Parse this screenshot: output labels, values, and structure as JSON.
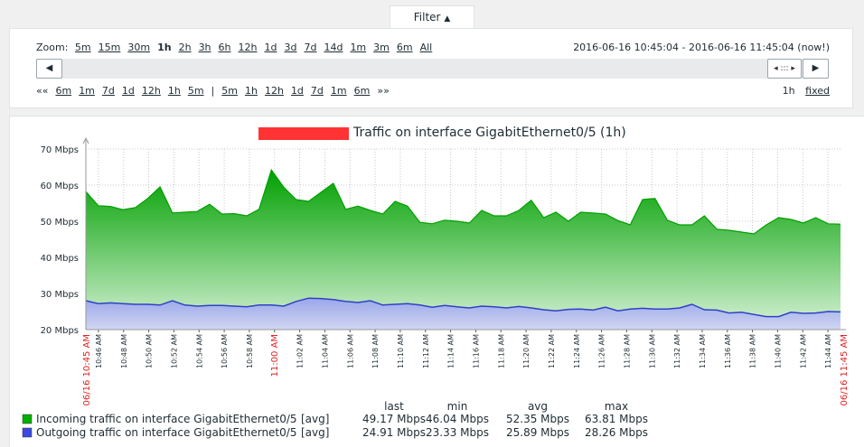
{
  "filter": {
    "label": "Filter",
    "arrow": "▲"
  },
  "zoom": {
    "label": "Zoom:",
    "options": [
      "5m",
      "15m",
      "30m",
      "1h",
      "2h",
      "3h",
      "6h",
      "12h",
      "1d",
      "3d",
      "7d",
      "14d",
      "1m",
      "3m",
      "6m",
      "All"
    ],
    "active": "1h"
  },
  "period_text": "2016-06-16 10:45:04 - 2016-06-16 11:45:04 (now!)",
  "scroll": {
    "left_arrow": "◀",
    "right_arrow": "▶",
    "handle": "◂ ::: ▸"
  },
  "nav": {
    "left_arrow": "««",
    "back": [
      "6m",
      "1m",
      "7d",
      "1d",
      "12h",
      "1h",
      "5m"
    ],
    "separator": "|",
    "forward": [
      "5m",
      "1h",
      "12h",
      "1d",
      "7d",
      "1m",
      "6m"
    ],
    "right_arrow": "»»"
  },
  "period_fixed": {
    "length": "1h",
    "mode": "fixed"
  },
  "colors": {
    "incoming": "#00a000",
    "outgoing": "#4a5acf",
    "red_marker": "#dd2222",
    "redaction": "#ff3333"
  },
  "chart_data": {
    "type": "area",
    "title": "Traffic on interface GigabitEthernet0/5 (1h)",
    "ylim": [
      20,
      70
    ],
    "y_ticks": [
      "70 Mbps",
      "60 Mbps",
      "50 Mbps",
      "40 Mbps",
      "30 Mbps",
      "20 Mbps"
    ],
    "y_tick_values": [
      70,
      60,
      50,
      40,
      30,
      20
    ],
    "x_start_label": "06/16 10:45 AM",
    "x_end_label": "06/16 11:45 AM",
    "x_tick_labels": [
      "10:46 AM",
      "10:48 AM",
      "10:50 AM",
      "10:52 AM",
      "10:54 AM",
      "10:56 AM",
      "10:58 AM",
      "11:00 AM",
      "11:02 AM",
      "11:04 AM",
      "11:06 AM",
      "11:08 AM",
      "11:10 AM",
      "11:12 AM",
      "11:14 AM",
      "11:16 AM",
      "11:18 AM",
      "11:20 AM",
      "11:22 AM",
      "11:24 AM",
      "11:26 AM",
      "11:28 AM",
      "11:30 AM",
      "11:32 AM",
      "11:34 AM",
      "11:36 AM",
      "11:38 AM",
      "11:40 AM",
      "11:42 AM",
      "11:44 AM"
    ],
    "x_tick_minutes": [
      1,
      3,
      5,
      7,
      9,
      11,
      13,
      15,
      17,
      19,
      21,
      23,
      25,
      27,
      29,
      31,
      33,
      35,
      37,
      39,
      41,
      43,
      45,
      47,
      49,
      51,
      53,
      55,
      57,
      59
    ],
    "x_red_labels": [
      "11:00 AM"
    ],
    "grid": true,
    "series": [
      {
        "name": "Incoming traffic on interface GigabitEthernet0/5",
        "values": [
          58.2,
          54.3,
          54.1,
          53.2,
          53.8,
          56.3,
          59.5,
          52.3,
          52.5,
          52.7,
          54.7,
          52.0,
          52.1,
          51.5,
          53.3,
          64.2,
          59.4,
          56.0,
          55.5,
          58.0,
          60.5,
          53.3,
          54.2,
          53.0,
          52.0,
          55.5,
          54.2,
          49.7,
          49.3,
          50.3,
          50.0,
          49.5,
          53.0,
          51.5,
          51.5,
          53.0,
          55.8,
          51.0,
          52.5,
          50.0,
          52.5,
          52.3,
          52.0,
          50.2,
          49.0,
          56.0,
          56.3,
          50.3,
          49.0,
          49.0,
          51.5,
          47.8,
          47.5,
          47.0,
          46.5,
          49.0,
          51.0,
          50.5,
          49.5,
          51.0,
          49.3,
          49.2
        ],
        "last": "49.17 Mbps",
        "min": "46.04 Mbps",
        "avg": "52.35 Mbps",
        "max": "63.81 Mbps"
      },
      {
        "name": "Outgoing traffic on interface GigabitEthernet0/5",
        "values": [
          28.0,
          27.2,
          27.4,
          27.2,
          27.0,
          27.0,
          26.8,
          28.0,
          26.8,
          26.5,
          26.7,
          26.7,
          26.5,
          26.3,
          26.8,
          26.8,
          26.5,
          27.8,
          28.7,
          28.6,
          28.3,
          27.8,
          27.5,
          28.0,
          26.8,
          27.0,
          27.2,
          26.8,
          26.2,
          26.7,
          26.3,
          26.0,
          26.5,
          26.3,
          26.0,
          26.4,
          26.0,
          25.5,
          25.2,
          25.6,
          25.7,
          25.4,
          26.2,
          25.2,
          25.7,
          25.9,
          25.7,
          25.7,
          26.0,
          27.0,
          25.5,
          25.4,
          24.6,
          24.8,
          24.2,
          23.6,
          23.6,
          24.8,
          24.5,
          24.6,
          25.0,
          24.9
        ],
        "last": "24.91 Mbps",
        "min": "23.33 Mbps",
        "avg": "25.89 Mbps",
        "max": "28.26 Mbps"
      }
    ],
    "legend_headers": [
      "last",
      "min",
      "avg",
      "max"
    ],
    "func_label": "[avg]"
  }
}
